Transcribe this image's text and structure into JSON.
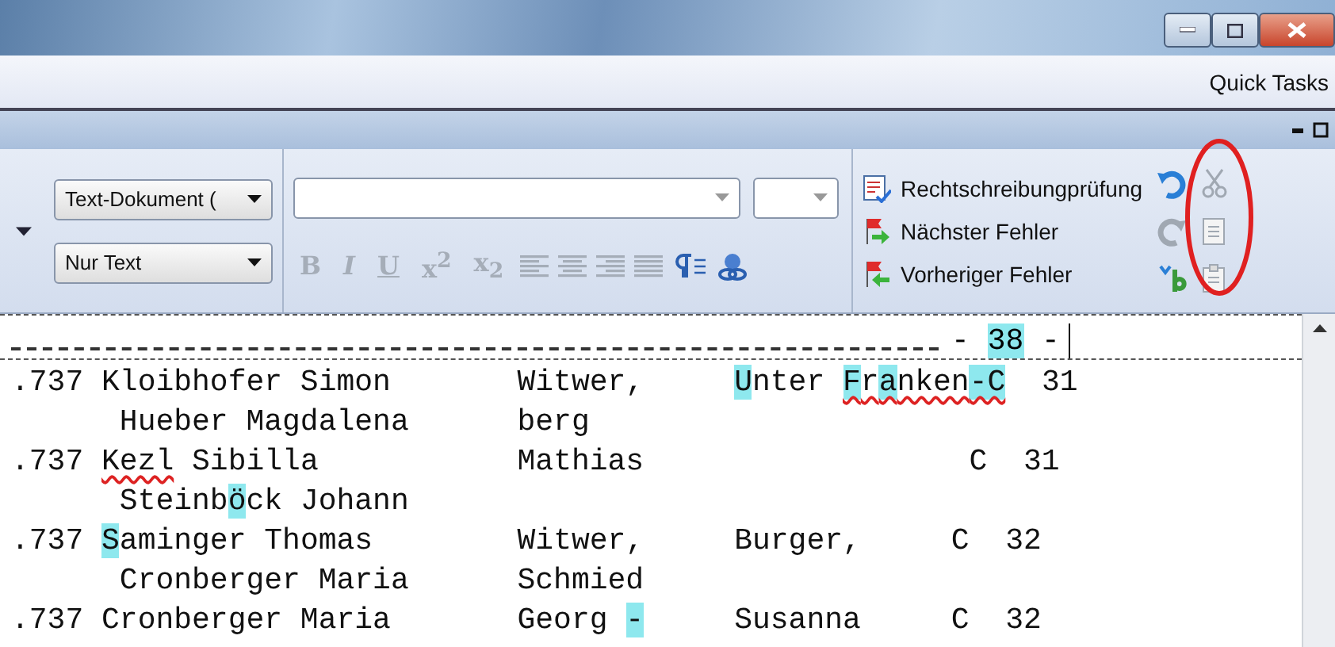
{
  "menu_bar": {
    "label": "Quick Tasks"
  },
  "ribbon": {
    "document_type": {
      "value": "Text-Dokument ("
    },
    "text_mode": {
      "value": "Nur Text"
    },
    "format_buttons": [
      {
        "label": "B",
        "disabled": true
      },
      {
        "label": "I",
        "disabled": true
      },
      {
        "label": "U",
        "disabled": true
      },
      {
        "label": "x$^{2}$",
        "disabled": true
      },
      {
        "label": "x$_{2}$",
        "disabled": true
      }
    ],
    "commands": [
      {
        "label": "Rechtschreibungprüfung",
        "kind": "spellcheck"
      },
      {
        "label": "Nächster Fehler",
        "kind": "next"
      },
      {
        "label": "Vorheriger Fehler",
        "kind": "previous"
      }
    ]
  },
  "document": {
    "page_marker": [
      {
        "text": "- ",
        "highlight": false,
        "misspelled": false
      },
      {
        "text": "38",
        "highlight": true,
        "misspelled": false
      },
      {
        "text": " -",
        "highlight": false,
        "misspelled": false
      }
    ],
    "lines": [
      [
        {
          "text": ".737 Kloibhofer Simon       Witwer,     ",
          "highlight": false,
          "misspelled": false
        },
        {
          "text": "U",
          "highlight": true,
          "misspelled": false
        },
        {
          "text": "nter ",
          "highlight": false,
          "misspelled": false
        },
        {
          "text": "F",
          "highlight": true,
          "misspelled": true
        },
        {
          "text": "r",
          "highlight": false,
          "misspelled": true
        },
        {
          "text": "a",
          "highlight": true,
          "misspelled": true
        },
        {
          "text": "nken",
          "highlight": false,
          "misspelled": true
        },
        {
          "text": "-C",
          "highlight": true,
          "misspelled": true
        },
        {
          "text": "  31",
          "highlight": false,
          "misspelled": false
        }
      ],
      [
        {
          "text": "      Hueber Magdalena      berg",
          "highlight": false,
          "misspelled": false
        }
      ],
      [
        {
          "text": ".737 ",
          "highlight": false,
          "misspelled": false
        },
        {
          "text": "Kezl",
          "highlight": false,
          "misspelled": true
        },
        {
          "text": " Sibilla           Mathias                  C  31",
          "highlight": false,
          "misspelled": false
        }
      ],
      [
        {
          "text": "      Steinb",
          "highlight": false,
          "misspelled": false
        },
        {
          "text": "ö",
          "highlight": true,
          "misspelled": false
        },
        {
          "text": "ck Johann",
          "highlight": false,
          "misspelled": false
        }
      ],
      [
        {
          "text": ".737 ",
          "highlight": false,
          "misspelled": false
        },
        {
          "text": "S",
          "highlight": true,
          "misspelled": false
        },
        {
          "text": "aminger Thomas        Witwer,     Burger,     C  32",
          "highlight": false,
          "misspelled": false
        }
      ],
      [
        {
          "text": "      Cronberger Maria      Schmied",
          "highlight": false,
          "misspelled": false
        }
      ],
      [
        {
          "text": ".737 Cronberger Maria       Georg ",
          "highlight": false,
          "misspelled": false
        },
        {
          "text": "-",
          "highlight": true,
          "misspelled": false
        },
        {
          "text": "     Susanna     C  32",
          "highlight": false,
          "misspelled": false
        }
      ]
    ]
  }
}
